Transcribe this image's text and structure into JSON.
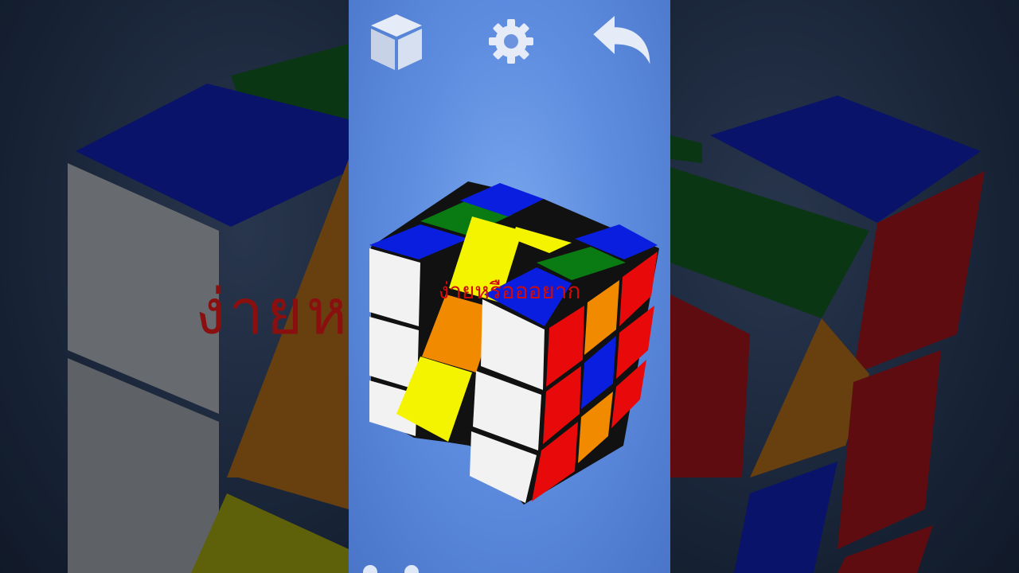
{
  "caption": "ง่ายหรือออยาก",
  "toolbar": {
    "left_icon": "cube-icon",
    "center_icon": "gear-icon",
    "right_icon": "undo-arrow-icon"
  },
  "colors": {
    "background": "#5e8de0",
    "caption": "#d10a0a",
    "cube_white": "#f2f2f2",
    "cube_blue": "#0a1ee0",
    "cube_green": "#0a7a12",
    "cube_yellow": "#f4f400",
    "cube_orange": "#f28a00",
    "cube_red": "#e80a0a"
  }
}
